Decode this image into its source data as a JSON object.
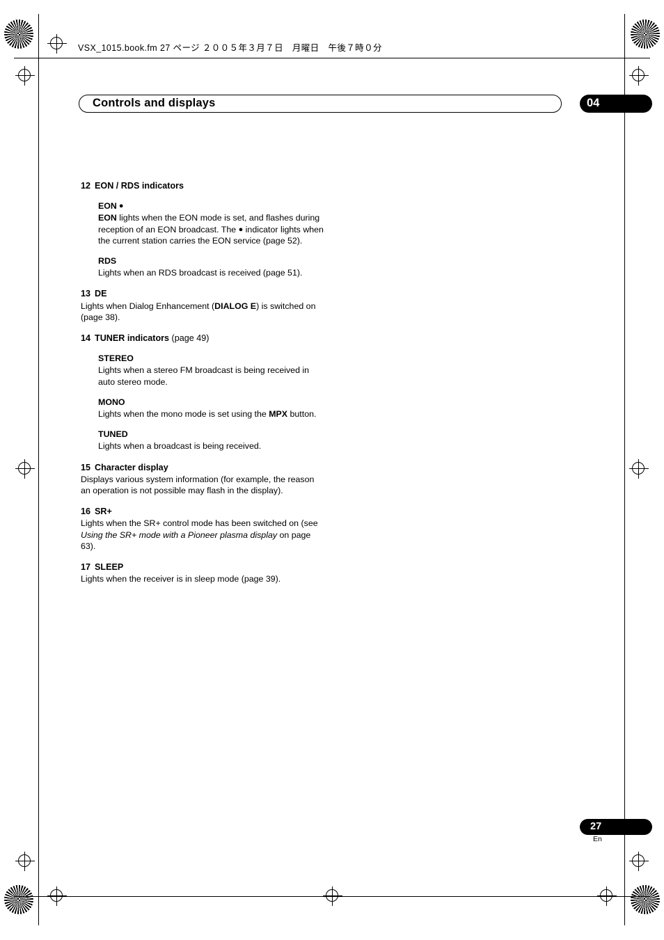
{
  "header": {
    "file_line": "VSX_1015.book.fm  27 ページ  ２００５年３月７日　月曜日　午後７時０分"
  },
  "chapter": {
    "title": "Controls and displays",
    "number": "04"
  },
  "sections": [
    {
      "num": "12",
      "title": "EON / RDS indicators",
      "subitems": [
        {
          "label": "EON",
          "label_suffix": " ●",
          "body_parts": [
            {
              "t": "EON",
              "style": "bold"
            },
            {
              "t": " lights when the EON mode is set, and flashes during reception of an EON broadcast. The ",
              "style": "normal"
            },
            {
              "t": "●",
              "style": "dot"
            },
            {
              "t": " indicator lights when the current station carries the EON service (page 52).",
              "style": "normal"
            }
          ]
        },
        {
          "label": "RDS",
          "label_suffix": "",
          "body_parts": [
            {
              "t": "Lights when an RDS broadcast is received (page 51).",
              "style": "normal"
            }
          ]
        }
      ]
    },
    {
      "num": "13",
      "title": "DE",
      "body_parts": [
        {
          "t": "Lights when Dialog Enhancement (",
          "style": "normal"
        },
        {
          "t": "DIALOG E",
          "style": "bold"
        },
        {
          "t": ") is switched on (page 38).",
          "style": "normal"
        }
      ]
    },
    {
      "num": "14",
      "title": "TUNER indicators",
      "title_light": " (page 49)",
      "subitems": [
        {
          "label": "STEREO",
          "label_suffix": "",
          "body_parts": [
            {
              "t": "Lights when a stereo FM broadcast is being received in auto stereo mode.",
              "style": "normal"
            }
          ]
        },
        {
          "label": "MONO",
          "label_suffix": "",
          "body_parts": [
            {
              "t": "Lights when the mono mode is set using the ",
              "style": "normal"
            },
            {
              "t": "MPX",
              "style": "bold"
            },
            {
              "t": " button.",
              "style": "normal"
            }
          ]
        },
        {
          "label": "TUNED",
          "label_suffix": "",
          "body_parts": [
            {
              "t": "Lights when a broadcast is being received.",
              "style": "normal"
            }
          ]
        }
      ]
    },
    {
      "num": "15",
      "title": "Character display",
      "body_parts": [
        {
          "t": "Displays various system information (for example, the reason an operation is not possible may flash in the display).",
          "style": "normal"
        }
      ]
    },
    {
      "num": "16",
      "title": "SR+",
      "body_parts": [
        {
          "t": "Lights when the SR+ control mode has been switched on (see ",
          "style": "normal"
        },
        {
          "t": "Using the SR+ mode with a Pioneer plasma display",
          "style": "italic"
        },
        {
          "t": " on page 63).",
          "style": "normal"
        }
      ]
    },
    {
      "num": "17",
      "title": "SLEEP",
      "body_parts": [
        {
          "t": "Lights when the receiver is in sleep mode (page 39).",
          "style": "normal"
        }
      ]
    }
  ],
  "footer": {
    "page_number": "27",
    "language": "En"
  }
}
